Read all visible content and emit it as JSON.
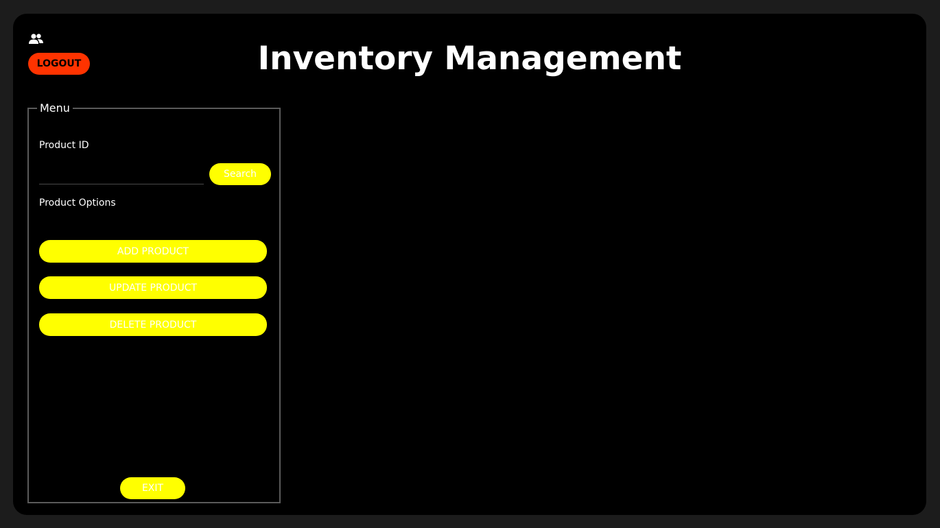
{
  "app": {
    "title": "Inventory Management"
  },
  "header": {
    "users_icon": "users-icon",
    "logout_label": "LOGOUT"
  },
  "menu": {
    "legend": "Menu",
    "product_id_label": "Product ID",
    "product_id_value": "",
    "search_label": "Search",
    "options_label": "Product Options",
    "buttons": {
      "add": "ADD PRODUCT",
      "update": "UPDATE PRODUCT",
      "delete": "DELETE PRODUCT"
    },
    "exit_label": "EXIT"
  },
  "colors": {
    "background": "#000000",
    "accent": "#ffff00",
    "logout": "#ff3300",
    "border": "#5a5a5a"
  }
}
